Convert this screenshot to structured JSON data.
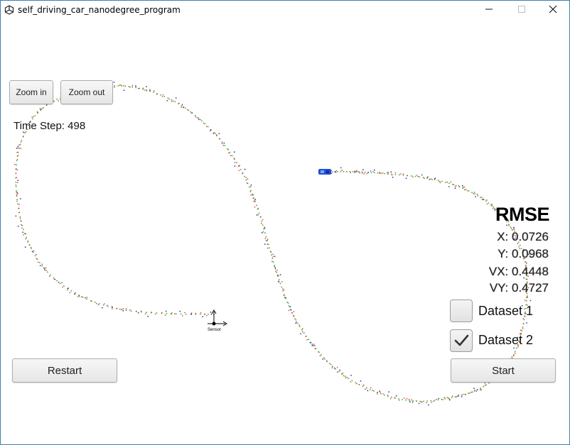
{
  "window": {
    "title": "self_driving_car_nanodegree_program",
    "app_icon": "unity-icon",
    "controls": [
      "minimize-icon",
      "maximize-icon",
      "close-icon"
    ]
  },
  "toolbar": {
    "zoom_in_label": "Zoom in",
    "zoom_out_label": "Zoom out"
  },
  "status": {
    "time_step": "Time Step: 498"
  },
  "rmse": {
    "title": "RMSE",
    "x": "X: 0.0726",
    "y": "Y: 0.0968",
    "vx": "VX: 0.4448",
    "vy": "VY: 0.4727"
  },
  "datasets": [
    {
      "label": "Dataset 1",
      "checked": false
    },
    {
      "label": "Dataset 2",
      "checked": true
    }
  ],
  "actions": {
    "restart_label": "Restart",
    "start_label": "Start"
  },
  "scene": {
    "sensor_label": "Sensor",
    "colors": {
      "estimate": "#2ab52a",
      "lidar": "#e03030",
      "radar": "#2040d0",
      "car": "#1e4fd8"
    }
  }
}
